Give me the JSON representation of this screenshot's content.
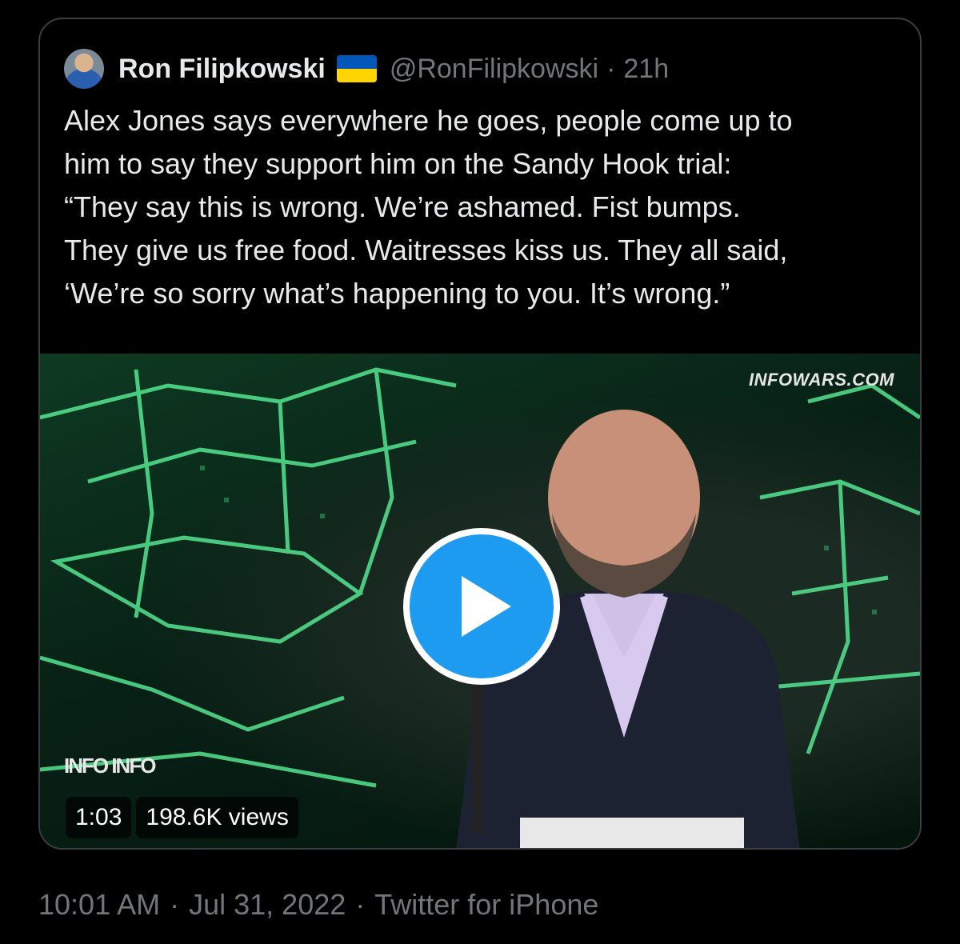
{
  "quoted_tweet": {
    "author": {
      "display_name": "Ron Filipkowski",
      "handle": "@RonFilipkowski",
      "flag_icon": "ukraine-flag-icon"
    },
    "separator": "·",
    "time_ago": "21h",
    "text": "Alex Jones says everywhere he goes, people come up to\nhim to say they support him on the Sandy Hook trial:\n“They say this is wrong. We’re ashamed. Fist bumps.\nThey give us free food. Waitresses kiss us. They all said,\n‘We’re so sorry what’s happening to you. It’s wrong.”",
    "media": {
      "type": "video",
      "watermark": "INFOWARS.COM",
      "channel_logo": "INFO INFO",
      "duration": "1:03",
      "views": "198.6K views",
      "play_icon": "play-icon"
    }
  },
  "meta": {
    "time": "10:01 AM",
    "separator": "·",
    "date": "Jul 31, 2022",
    "source": "Twitter for iPhone"
  },
  "colors": {
    "background": "#000000",
    "text": "#e7e9ea",
    "secondary_text": "#71767b",
    "border": "#3a3d41",
    "accent": "#1d9bf0"
  }
}
